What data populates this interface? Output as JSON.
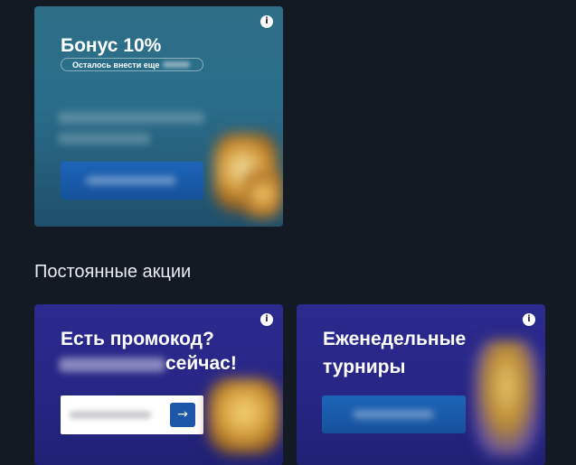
{
  "bonus_card": {
    "title": "Бонус 10%",
    "remaining_label": "Осталось внести еще",
    "info_icon": "info-icon",
    "button_icon_name": "redacted-button",
    "accent_color": "#2a6d8a"
  },
  "section": {
    "title": "Постоянные акции"
  },
  "promo_card": {
    "title": "Есть промокод?",
    "subtitle_visible_part": "сейчас!",
    "submit_icon": "arrow-right-icon",
    "submit_glyph": "→",
    "background_color": "#272584"
  },
  "tournaments_card": {
    "title_line1": "Еженедельные",
    "title_line2": "турниры",
    "background_color": "#272584"
  },
  "icons": {
    "info_glyph": "i"
  },
  "colors": {
    "page_background": "#131a24",
    "button_blue": "#1c64b8"
  }
}
